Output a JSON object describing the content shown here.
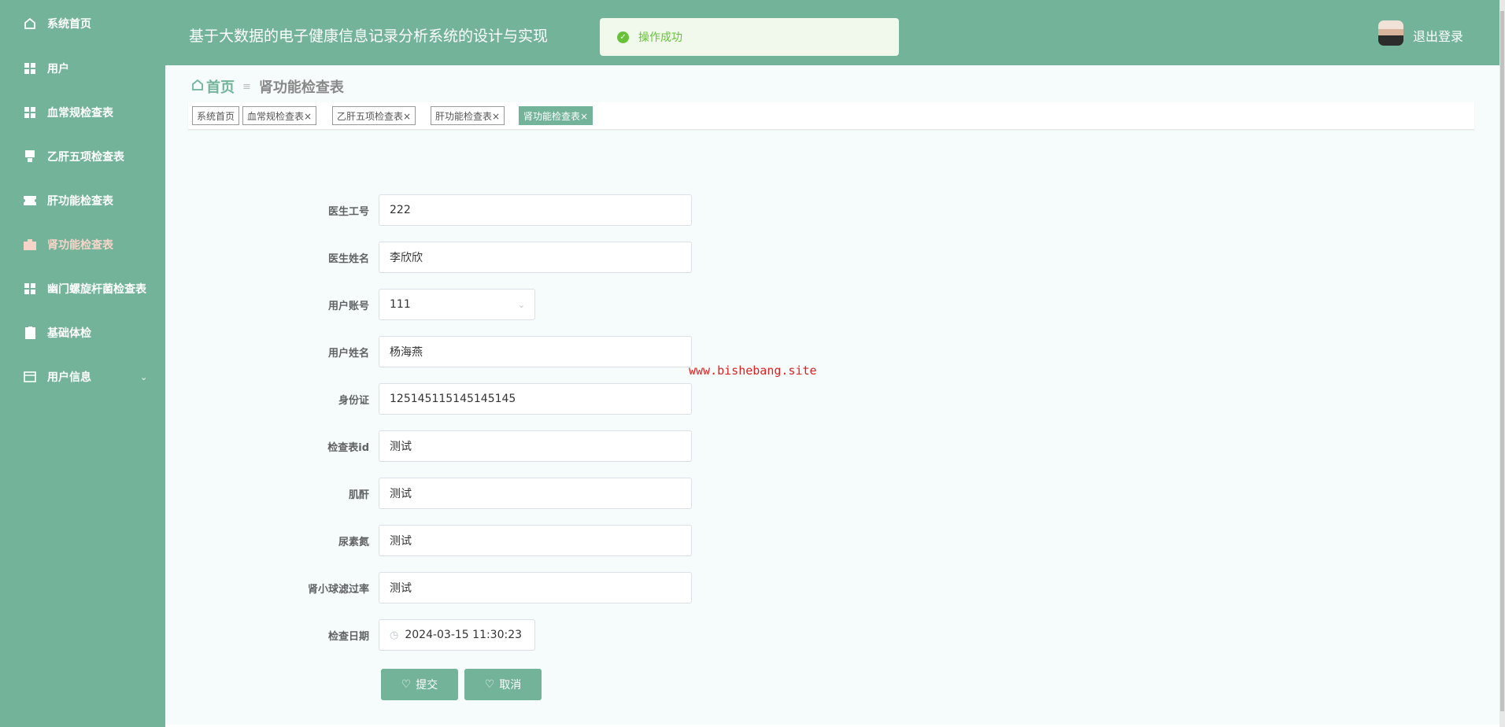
{
  "sidebar": {
    "items": [
      {
        "label": "系统首页",
        "icon": "home-icon"
      },
      {
        "label": "用户",
        "icon": "grid-icon"
      },
      {
        "label": "血常规检查表",
        "icon": "grid-icon"
      },
      {
        "label": "乙肝五项检查表",
        "icon": "flag-icon"
      },
      {
        "label": "肝功能检查表",
        "icon": "ticket-icon"
      },
      {
        "label": "肾功能检查表",
        "icon": "briefcase-icon"
      },
      {
        "label": "幽门螺旋杆菌检查表",
        "icon": "grid-icon"
      },
      {
        "label": "基础体检",
        "icon": "clipboard-icon"
      },
      {
        "label": "用户信息",
        "icon": "card-icon"
      }
    ]
  },
  "header": {
    "title": "基于大数据的电子健康信息记录分析系统的设计与实现",
    "logout": "退出登录"
  },
  "toast": {
    "message": "操作成功"
  },
  "breadcrumb": {
    "home": "首页",
    "current": "肾功能检查表"
  },
  "tabs": [
    {
      "label": "系统首页"
    },
    {
      "label": "血常规检查表×"
    },
    {
      "label": "乙肝五项检查表×"
    },
    {
      "label": "肝功能检查表×"
    },
    {
      "label": "肾功能检查表×"
    }
  ],
  "form": {
    "fields": [
      {
        "label": "医生工号",
        "value": "222"
      },
      {
        "label": "医生姓名",
        "value": "李欣欣"
      },
      {
        "label": "用户账号",
        "value": "111"
      },
      {
        "label": "用户姓名",
        "value": "杨海燕"
      },
      {
        "label": "身份证",
        "value": "125145115145145145"
      },
      {
        "label": "检查表id",
        "value": "测试"
      },
      {
        "label": "肌酐",
        "value": "测试"
      },
      {
        "label": "尿素氮",
        "value": "测试"
      },
      {
        "label": "肾小球滤过率",
        "value": "测试"
      },
      {
        "label": "检查日期",
        "value": "2024-03-15 11:30:23"
      }
    ],
    "submit": "提交",
    "cancel": "取消"
  },
  "watermark": "www.bishebang.site",
  "colors": {
    "primary": "#72b39a",
    "success": "#67c23a"
  }
}
